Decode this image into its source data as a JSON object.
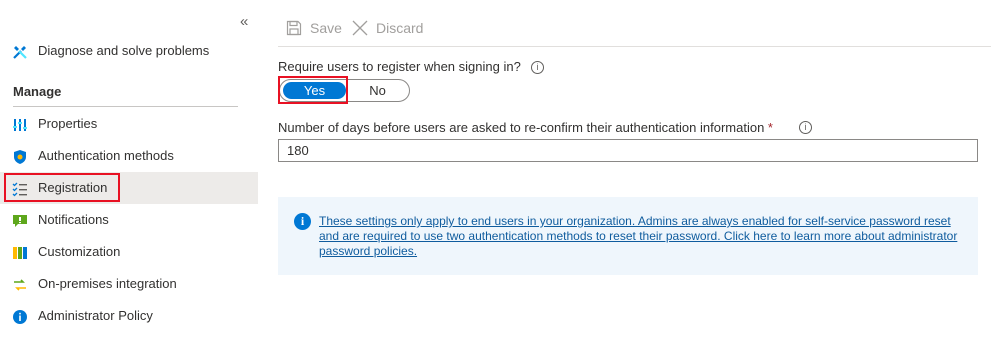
{
  "sidebar": {
    "collapse_glyph": "«",
    "top_item": {
      "label": "Diagnose and solve problems",
      "icon": "wrench-icon"
    },
    "section_title": "Manage",
    "items": [
      {
        "label": "Properties",
        "icon": "properties-icon"
      },
      {
        "label": "Authentication methods",
        "icon": "shield-icon"
      },
      {
        "label": "Registration",
        "icon": "checklist-icon",
        "selected": true
      },
      {
        "label": "Notifications",
        "icon": "notification-icon"
      },
      {
        "label": "Customization",
        "icon": "customization-icon"
      },
      {
        "label": "On-premises integration",
        "icon": "sync-icon"
      },
      {
        "label": "Administrator Policy",
        "icon": "info-icon"
      }
    ]
  },
  "toolbar": {
    "save_label": "Save",
    "discard_label": "Discard"
  },
  "form": {
    "require_label": "Require users to register when signing in?",
    "toggle": {
      "yes_label": "Yes",
      "no_label": "No",
      "selected": "Yes"
    },
    "days_label": "Number of days before users are asked to re-confirm their authentication information",
    "required_marker": "*",
    "days_value": "180",
    "info_text": "These settings only apply to end users in your organization. Admins are always enabled for self-service password reset and are required to use two authentication methods to reset their password. Click here to learn more about administrator password policies."
  },
  "colors": {
    "accent": "#0078d4",
    "highlight": "#e81123",
    "info_bg": "#eff6fc",
    "link": "#0f5c9e"
  }
}
